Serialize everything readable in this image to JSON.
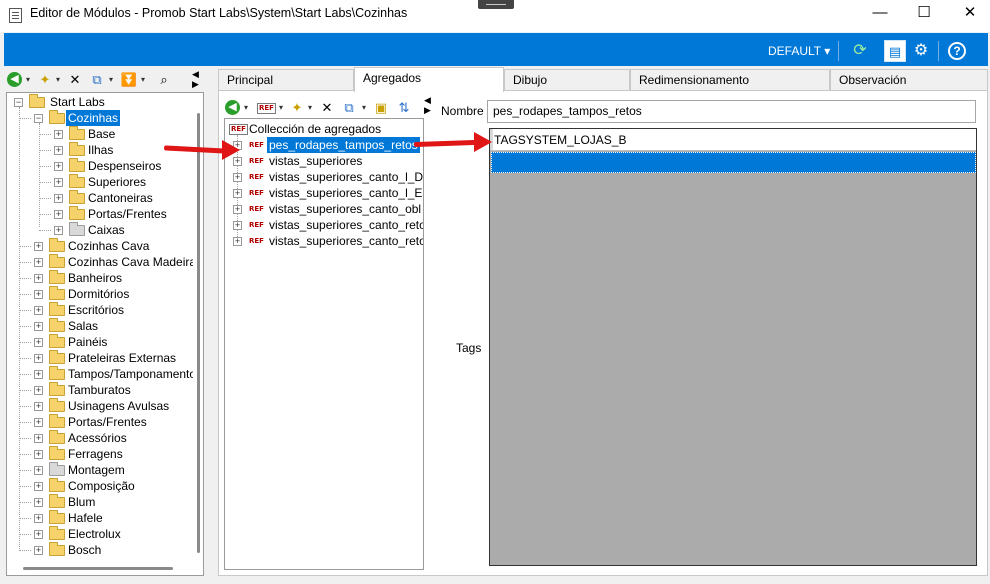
{
  "window": {
    "title": "Editor de Módulos - Promob Start Labs\\System\\Start Labs\\Cozinhas",
    "controls": {
      "minimize": "—",
      "maximize": "☐",
      "close": "✕"
    }
  },
  "ribbon": {
    "profile": "DEFAULT ▾",
    "icons": [
      "refresh-icon",
      "layout-icon",
      "settings-icon",
      "help-icon"
    ]
  },
  "left_tree": {
    "root": "Start Labs",
    "items": [
      {
        "label": "Cozinhas",
        "level": 1,
        "expanded": true,
        "selected": true
      },
      {
        "label": "Base",
        "level": 2
      },
      {
        "label": "Ilhas",
        "level": 2
      },
      {
        "label": "Despenseiros",
        "level": 2
      },
      {
        "label": "Superiores",
        "level": 2
      },
      {
        "label": "Cantoneiras",
        "level": 2
      },
      {
        "label": "Portas/Frentes",
        "level": 2
      },
      {
        "label": "Caixas",
        "level": 2,
        "grey": true
      },
      {
        "label": "Cozinhas Cava",
        "level": 1
      },
      {
        "label": "Cozinhas Cava Madeira",
        "level": 1
      },
      {
        "label": "Banheiros",
        "level": 1
      },
      {
        "label": "Dormitórios",
        "level": 1
      },
      {
        "label": "Escritórios",
        "level": 1
      },
      {
        "label": "Salas",
        "level": 1
      },
      {
        "label": "Painéis",
        "level": 1
      },
      {
        "label": "Prateleiras Externas",
        "level": 1
      },
      {
        "label": "Tampos/Tamponamento",
        "level": 1
      },
      {
        "label": "Tamburatos",
        "level": 1
      },
      {
        "label": "Usinagens Avulsas",
        "level": 1
      },
      {
        "label": "Portas/Frentes",
        "level": 1
      },
      {
        "label": "Acessórios",
        "level": 1
      },
      {
        "label": "Ferragens",
        "level": 1
      },
      {
        "label": "Montagem",
        "level": 1,
        "grey": true
      },
      {
        "label": "Composição",
        "level": 1
      },
      {
        "label": "Blum",
        "level": 1
      },
      {
        "label": "Hafele",
        "level": 1
      },
      {
        "label": "Electrolux",
        "level": 1
      },
      {
        "label": "Bosch",
        "level": 1
      }
    ]
  },
  "tabs": [
    {
      "label": "Principal",
      "active": false
    },
    {
      "label": "Agregados",
      "active": true
    },
    {
      "label": "Dibujo",
      "active": false
    },
    {
      "label": "Redimensionamento",
      "active": false
    },
    {
      "label": "Observación",
      "active": false
    }
  ],
  "aggregates": {
    "root": "Collección de agregados",
    "ref_icon": "REF",
    "items": [
      {
        "label": "pes_rodapes_tampos_retos",
        "selected": true
      },
      {
        "label": "vistas_superiores"
      },
      {
        "label": "vistas_superiores_canto_l_Dir"
      },
      {
        "label": "vistas_superiores_canto_l_Esq"
      },
      {
        "label": "vistas_superiores_canto_obl"
      },
      {
        "label": "vistas_superiores_canto_reto_d"
      },
      {
        "label": "vistas_superiores_canto_reto_e"
      }
    ]
  },
  "form": {
    "nombre_label": "Nombre",
    "nombre_value": "pes_rodapes_tampos_retos",
    "tags_label": "Tags",
    "tags": [
      "TAGSYSTEM_LOJAS_B"
    ]
  },
  "colors": {
    "accent": "#0078d7",
    "arrow": "#e01515",
    "grid_bg": "#ababab"
  }
}
